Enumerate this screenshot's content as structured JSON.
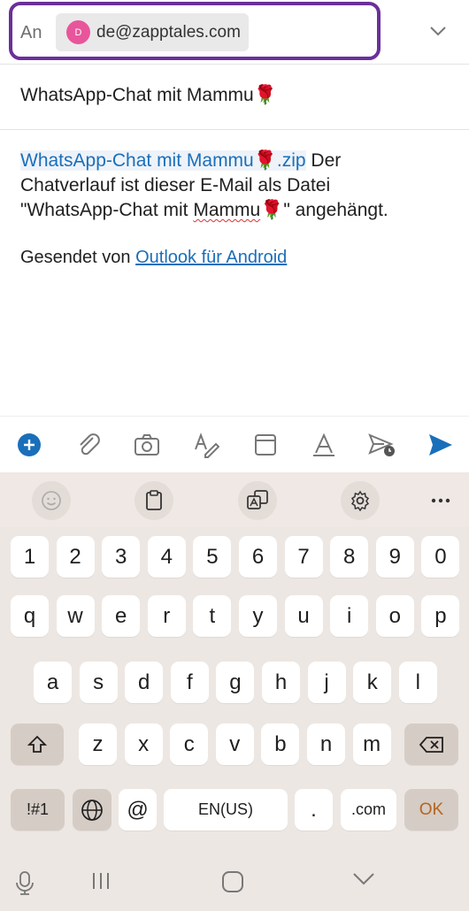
{
  "compose": {
    "to_label": "An",
    "recipient_initial": "D",
    "recipient_email": "de@zapptales.com",
    "subject": "WhatsApp-Chat mit Mammu🌹",
    "attachment_name": "WhatsApp-Chat mit Mammu🌹.zip",
    "body_line_1_rest": " Der",
    "body_line_2": "Chatverlauf ist dieser E-Mail als Datei",
    "body_line_3_a": "\"WhatsApp-Chat mit ",
    "body_line_3_b": "Mammu",
    "body_line_3_c": "🌹\" angehängt.",
    "signature_prefix": "Gesendet von ",
    "signature_link": "Outlook für Android"
  },
  "toolbar": {
    "icons": [
      "add-icon",
      "attach-icon",
      "camera-icon",
      "format-icon",
      "template-icon",
      "signature-icon",
      "schedule-send-icon",
      "send-icon"
    ],
    "accent": "#1a6fba"
  },
  "keyboard": {
    "strip_icons": [
      "emoji-icon",
      "clipboard-icon",
      "translate-icon",
      "settings-icon",
      "more-icon"
    ],
    "row_numbers": [
      "1",
      "2",
      "3",
      "4",
      "5",
      "6",
      "7",
      "8",
      "9",
      "0"
    ],
    "row_top": [
      "q",
      "w",
      "e",
      "r",
      "t",
      "y",
      "u",
      "i",
      "o",
      "p"
    ],
    "row_mid": [
      "a",
      "s",
      "d",
      "f",
      "g",
      "h",
      "j",
      "k",
      "l"
    ],
    "row_bot": [
      "z",
      "x",
      "c",
      "v",
      "b",
      "n",
      "m"
    ],
    "symbols_label": "!#1",
    "at_label": "@",
    "space_label": "EN(US)",
    "period_label": ".",
    "dotcom_label": ".com",
    "ok_label": "OK"
  }
}
